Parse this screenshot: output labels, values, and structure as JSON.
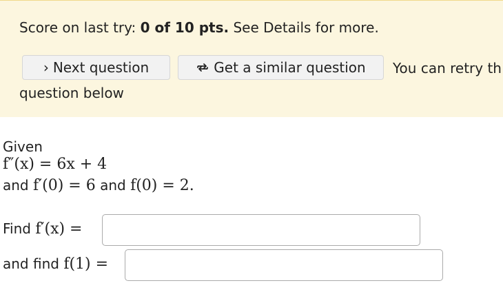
{
  "banner": {
    "score_prefix": "Score on last try: ",
    "score_value": "0 of 10 pts.",
    "score_suffix": " See Details for more.",
    "next_button_label": "Next question",
    "similar_button_label": "Get a similar question",
    "retry_text_1": "You can retry th",
    "retry_text_2": "question below",
    "colors": {
      "banner_background": "#fcf6df",
      "banner_border": "#f0d98a",
      "button_background": "#f2f2f2"
    },
    "icons": {
      "next": "chevron-right-icon",
      "similar": "refresh-arrows-icon"
    }
  },
  "question": {
    "given_label": "Given",
    "second_derivative": "f″(x) = 6x + 4",
    "and_label": "and",
    "first_condition": "f′(0) = 6",
    "and_label_2": "and",
    "second_condition": "f(0) = 2.",
    "find_label": "Find",
    "find_expr": "f′(x) =",
    "and_find_label": "and find",
    "and_find_expr": "f(1) ="
  },
  "answers": {
    "first_value": "",
    "second_value": ""
  }
}
